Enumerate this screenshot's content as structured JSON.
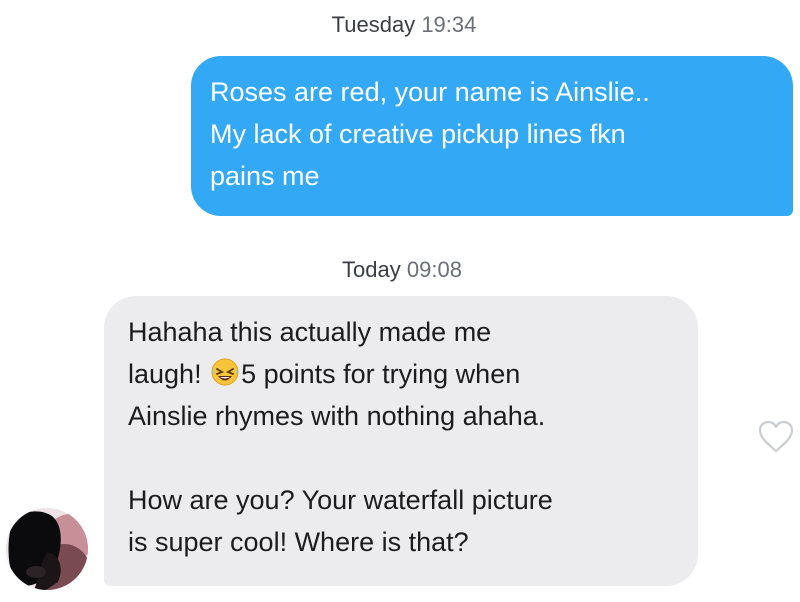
{
  "conversation": {
    "timestamps": [
      {
        "day": "Tuesday",
        "time": "19:34"
      },
      {
        "day": "Today",
        "time": "09:08"
      }
    ],
    "sent_message": {
      "lines": [
        "Roses are red, your name is Ainslie..",
        "My lack of creative pickup lines fkn",
        "pains me"
      ],
      "color": "#33a8f5"
    },
    "received_message": {
      "line1": "Hahaha this actually made me",
      "line2_before": "laugh! ",
      "line2_emoji": "rolling-on-floor-laughing-emoji",
      "line2_after": "5 points for trying when",
      "line3": "Ainslie rhymes with nothing ahaha.",
      "line4": "How are you? Your waterfall picture",
      "line5": "is super cool! Where is that?",
      "color": "#ececee"
    },
    "icons": {
      "like": "heart-outline-icon",
      "avatar": "profile-avatar"
    }
  }
}
